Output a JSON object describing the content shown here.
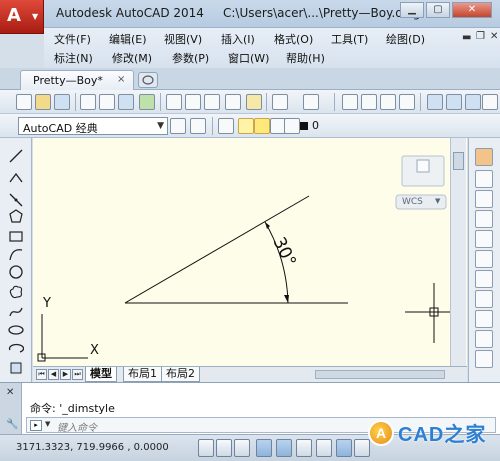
{
  "app": {
    "title": "Autodesk AutoCAD 2014",
    "file_path": "C:\\Users\\acer\\...\\Pretty—Boy.dwg",
    "logo_letter": "A"
  },
  "menu": {
    "row1": [
      "文件(F)",
      "编辑(E)",
      "视图(V)",
      "插入(I)",
      "格式(O)",
      "工具(T)",
      "绘图(D)"
    ],
    "row2": [
      "标注(N)",
      "修改(M)",
      "参数(P)",
      "窗口(W)",
      "帮助(H)"
    ]
  },
  "tabs": {
    "active": "Pretty—Boy*",
    "close": "×"
  },
  "toolbar": {
    "workspace": "AutoCAD 经典",
    "layer": "0"
  },
  "drawing": {
    "angle_label": "30°",
    "wcs_label": "WCS",
    "ucs_y": "Y",
    "ucs_x": "X"
  },
  "layout_tabs": [
    "模型",
    "布局1",
    "布局2"
  ],
  "command": {
    "history": "命令: '_dimstyle",
    "placeholder": "键入命令"
  },
  "status": {
    "coordinates": "3171.3323, 719.9966 , 0.0000"
  },
  "watermark": {
    "text": "CAD之家",
    "logo": "A"
  },
  "colors": {
    "canvas": "#fdfde9",
    "app_button": "#c62d1f",
    "accent": "#2d7fd1"
  }
}
